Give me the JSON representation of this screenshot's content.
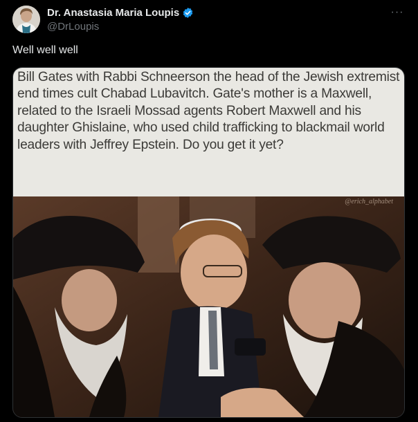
{
  "author": {
    "name": "Dr. Anastasia Maria Loupis",
    "handle": "@DrLoupis",
    "verified_icon": "verified-badge-icon",
    "accent_color": "#1d9bf0"
  },
  "post": {
    "text": "Well well well",
    "more_icon": "more-options-icon",
    "more_glyph": "···"
  },
  "media": {
    "caption": "Bill Gates with Rabbi Schneerson the head of the Jewish extremist end times cult Chabad Lubavitch. Gate's mother is a Maxwell, related to the Israeli Mossad agents Robert Maxwell and his daughter Ghislaine, who used child trafficking to blackmail world leaders with Jeffrey Epstein. Do you get it yet?",
    "watermark": "@erich_alphabet"
  }
}
